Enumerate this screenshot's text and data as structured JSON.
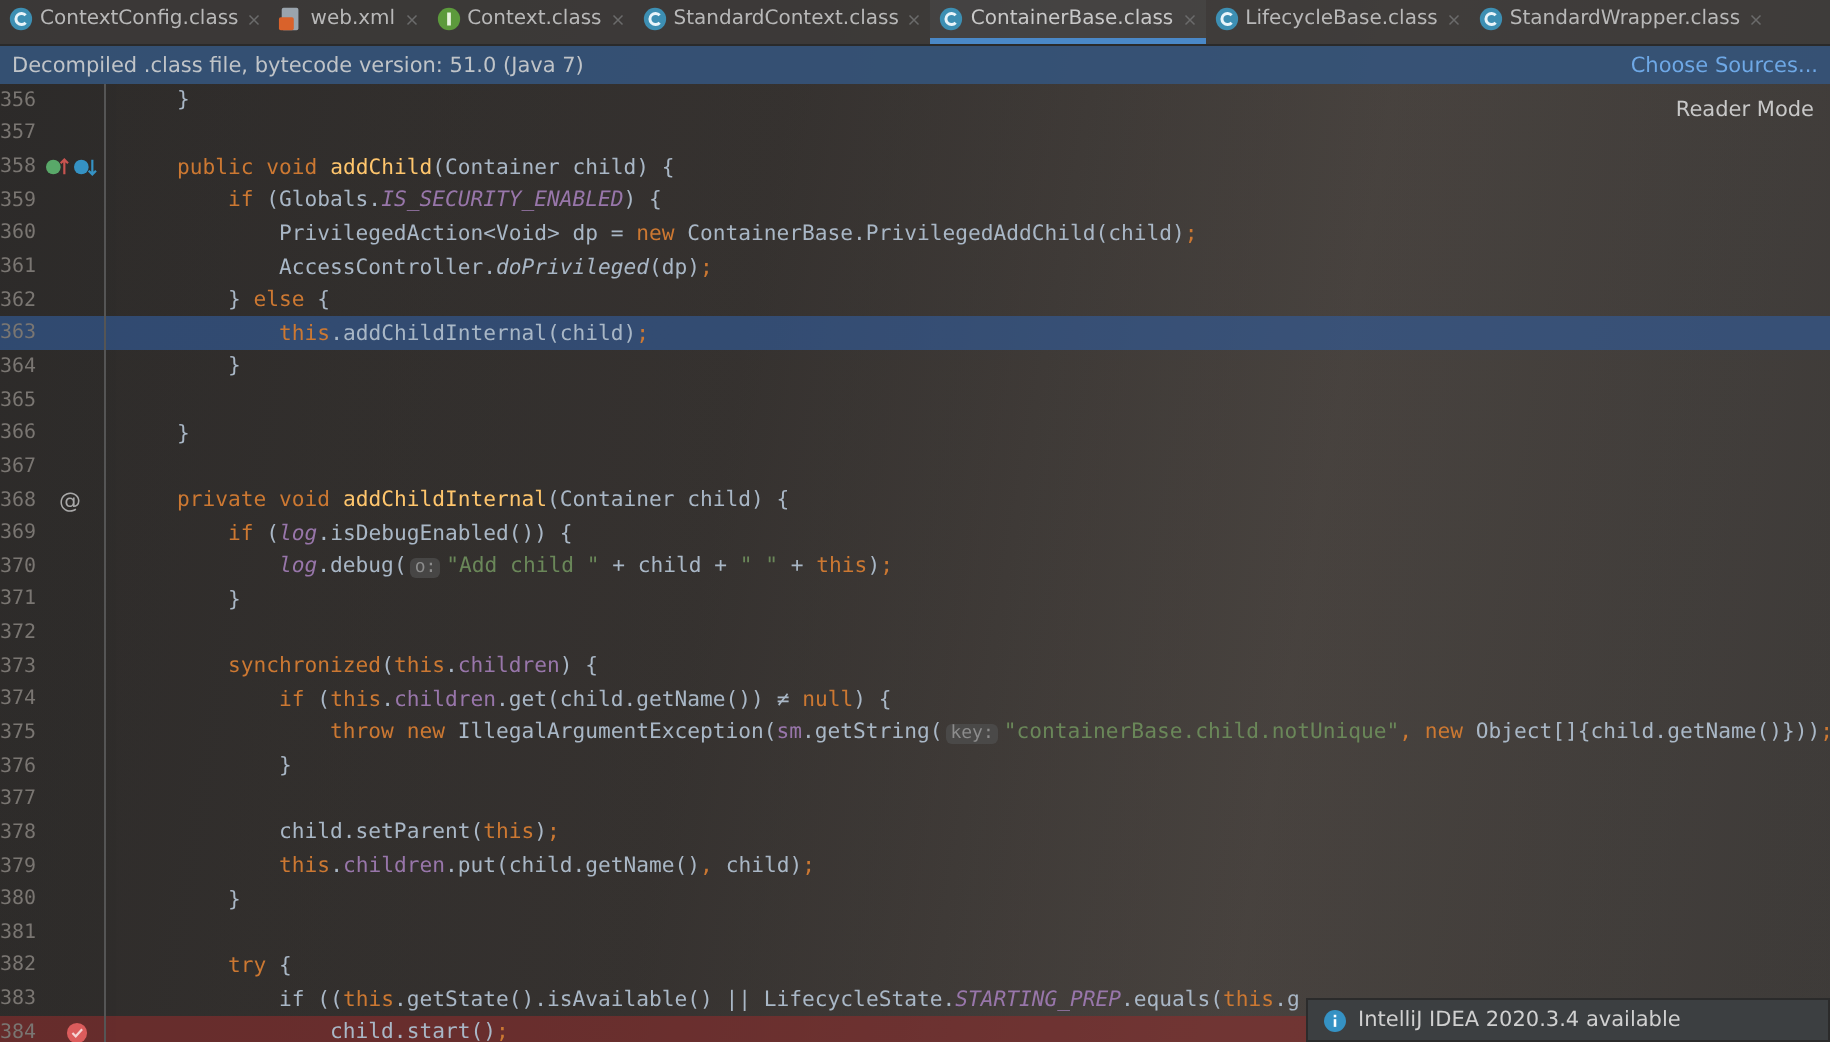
{
  "tabs": [
    {
      "label": "ContextConfig.class",
      "kind": "class",
      "selected": false
    },
    {
      "label": "web.xml",
      "kind": "xml",
      "selected": false
    },
    {
      "label": "Context.class",
      "kind": "interface",
      "selected": false
    },
    {
      "label": "StandardContext.class",
      "kind": "class",
      "selected": false
    },
    {
      "label": "ContainerBase.class",
      "kind": "class",
      "selected": true
    },
    {
      "label": "LifecycleBase.class",
      "kind": "class",
      "selected": false
    },
    {
      "label": "StandardWrapper.class",
      "kind": "class",
      "selected": false
    }
  ],
  "banner": {
    "message": "Decompiled .class file, bytecode version: 51.0 (Java 7)",
    "link": "Choose Sources..."
  },
  "reader_mode": "Reader Mode",
  "lines": [
    {
      "number": "356",
      "selected": false,
      "breakpoint": false,
      "tokens": [
        {
          "kind": "plain",
          "text": "    }"
        }
      ]
    },
    {
      "number": "357",
      "selected": false,
      "breakpoint": false
    },
    {
      "number": "358",
      "selected": false,
      "breakpoint": false,
      "gutter": [
        {
          "kind": "implemented"
        },
        {
          "kind": "overridden"
        }
      ],
      "tokens": [
        {
          "kind": "keyword",
          "text": "    public void "
        },
        {
          "kind": "declaration",
          "text": "addChild"
        },
        {
          "kind": "plain",
          "text": "(Container child) {"
        }
      ]
    },
    {
      "number": "359",
      "selected": false,
      "breakpoint": false,
      "tokens": [
        {
          "kind": "keyword",
          "text": "        if"
        },
        {
          "kind": "plain",
          "text": " (Globals."
        },
        {
          "kind": "static",
          "text": "IS_SECURITY_ENABLED"
        },
        {
          "kind": "plain",
          "text": ") {"
        }
      ]
    },
    {
      "number": "360",
      "selected": false,
      "breakpoint": false,
      "tokens": [
        {
          "kind": "plain",
          "text": "            PrivilegedAction<Void> dp = "
        },
        {
          "kind": "keyword",
          "text": "new"
        },
        {
          "kind": "plain",
          "text": " ContainerBase.PrivilegedAddChild(child)"
        },
        {
          "kind": "keyword",
          "text": ";"
        }
      ]
    },
    {
      "number": "361",
      "selected": false,
      "breakpoint": false,
      "tokens": [
        {
          "kind": "plain",
          "text": "            AccessController."
        },
        {
          "kind": "italic",
          "text": "doPrivileged"
        },
        {
          "kind": "plain",
          "text": "(dp)"
        },
        {
          "kind": "keyword",
          "text": ";"
        }
      ]
    },
    {
      "number": "362",
      "selected": false,
      "breakpoint": false,
      "tokens": [
        {
          "kind": "plain",
          "text": "        } "
        },
        {
          "kind": "keyword",
          "text": "else"
        },
        {
          "kind": "plain",
          "text": " {"
        }
      ]
    },
    {
      "number": "363",
      "selected": true,
      "breakpoint": false,
      "tokens": [
        {
          "kind": "keyword",
          "text": "            this"
        },
        {
          "kind": "plain",
          "text": ".addChildInternal(child)"
        },
        {
          "kind": "keyword",
          "text": ";"
        }
      ]
    },
    {
      "number": "364",
      "selected": false,
      "breakpoint": false,
      "tokens": [
        {
          "kind": "plain",
          "text": "        }"
        }
      ]
    },
    {
      "number": "365",
      "selected": false,
      "breakpoint": false
    },
    {
      "number": "366",
      "selected": false,
      "breakpoint": false,
      "tokens": [
        {
          "kind": "plain",
          "text": "    }"
        }
      ]
    },
    {
      "number": "367",
      "selected": false,
      "breakpoint": false
    },
    {
      "number": "368",
      "selected": false,
      "breakpoint": false,
      "gutter": [
        {
          "kind": "text",
          "text": "@"
        }
      ],
      "tokens": [
        {
          "kind": "keyword",
          "text": "    private void "
        },
        {
          "kind": "declaration",
          "text": "addChildInternal"
        },
        {
          "kind": "plain",
          "text": "(Container child) {"
        }
      ]
    },
    {
      "number": "369",
      "selected": false,
      "breakpoint": false,
      "tokens": [
        {
          "kind": "keyword",
          "text": "        if"
        },
        {
          "kind": "plain",
          "text": " ("
        },
        {
          "kind": "field-italic",
          "text": "log"
        },
        {
          "kind": "plain",
          "text": ".isDebugEnabled()) {"
        }
      ]
    },
    {
      "number": "370",
      "selected": false,
      "breakpoint": false,
      "tokens": [
        {
          "kind": "field-italic",
          "text": "            log"
        },
        {
          "kind": "plain",
          "text": ".debug("
        },
        {
          "kind": "hint",
          "text": "o:"
        },
        {
          "kind": "string",
          "text": "\"Add child \""
        },
        {
          "kind": "plain",
          "text": " + child + "
        },
        {
          "kind": "string",
          "text": "\" \""
        },
        {
          "kind": "plain",
          "text": " + "
        },
        {
          "kind": "keyword",
          "text": "this"
        },
        {
          "kind": "plain",
          "text": ")"
        },
        {
          "kind": "keyword",
          "text": ";"
        }
      ]
    },
    {
      "number": "371",
      "selected": false,
      "breakpoint": false,
      "tokens": [
        {
          "kind": "plain",
          "text": "        }"
        }
      ]
    },
    {
      "number": "372",
      "selected": false,
      "breakpoint": false
    },
    {
      "number": "373",
      "selected": false,
      "breakpoint": false,
      "tokens": [
        {
          "kind": "keyword",
          "text": "        synchronized"
        },
        {
          "kind": "plain",
          "text": "("
        },
        {
          "kind": "keyword",
          "text": "this"
        },
        {
          "kind": "plain",
          "text": "."
        },
        {
          "kind": "field",
          "text": "children"
        },
        {
          "kind": "plain",
          "text": ") {"
        }
      ]
    },
    {
      "number": "374",
      "selected": false,
      "breakpoint": false,
      "tokens": [
        {
          "kind": "keyword",
          "text": "            if"
        },
        {
          "kind": "plain",
          "text": " ("
        },
        {
          "kind": "keyword",
          "text": "this"
        },
        {
          "kind": "plain",
          "text": "."
        },
        {
          "kind": "field",
          "text": "children"
        },
        {
          "kind": "plain",
          "text": ".get(child.getName()) ≠ "
        },
        {
          "kind": "keyword",
          "text": "null"
        },
        {
          "kind": "plain",
          "text": ") {"
        }
      ]
    },
    {
      "number": "375",
      "selected": false,
      "breakpoint": false,
      "tokens": [
        {
          "kind": "keyword",
          "text": "                throw new"
        },
        {
          "kind": "plain",
          "text": " IllegalArgumentException("
        },
        {
          "kind": "field",
          "text": "sm"
        },
        {
          "kind": "plain",
          "text": ".getString("
        },
        {
          "kind": "hint",
          "text": "key:"
        },
        {
          "kind": "string",
          "text": "\"containerBase.child.notUnique\""
        },
        {
          "kind": "keyword",
          "text": ", new"
        },
        {
          "kind": "plain",
          "text": " Object[]{child.getName()}))"
        },
        {
          "kind": "keyword",
          "text": ";"
        }
      ]
    },
    {
      "number": "376",
      "selected": false,
      "breakpoint": false,
      "tokens": [
        {
          "kind": "plain",
          "text": "            }"
        }
      ]
    },
    {
      "number": "377",
      "selected": false,
      "breakpoint": false
    },
    {
      "number": "378",
      "selected": false,
      "breakpoint": false,
      "tokens": [
        {
          "kind": "plain",
          "text": "            child.setParent("
        },
        {
          "kind": "keyword",
          "text": "this"
        },
        {
          "kind": "plain",
          "text": ")"
        },
        {
          "kind": "keyword",
          "text": ";"
        }
      ]
    },
    {
      "number": "379",
      "selected": false,
      "breakpoint": false,
      "tokens": [
        {
          "kind": "keyword",
          "text": "            this"
        },
        {
          "kind": "plain",
          "text": "."
        },
        {
          "kind": "field",
          "text": "children"
        },
        {
          "kind": "plain",
          "text": ".put(child.getName()"
        },
        {
          "kind": "keyword",
          "text": ","
        },
        {
          "kind": "plain",
          "text": " child)"
        },
        {
          "kind": "keyword",
          "text": ";"
        }
      ]
    },
    {
      "number": "380",
      "selected": false,
      "breakpoint": false,
      "tokens": [
        {
          "kind": "plain",
          "text": "        }"
        }
      ]
    },
    {
      "number": "381",
      "selected": false,
      "breakpoint": false
    },
    {
      "number": "382",
      "selected": false,
      "breakpoint": false,
      "tokens": [
        {
          "kind": "keyword",
          "text": "        try"
        },
        {
          "kind": "plain",
          "text": " {"
        }
      ]
    },
    {
      "number": "383",
      "selected": false,
      "breakpoint": false,
      "tokens": [
        {
          "kind": "plain",
          "text": "            if (("
        },
        {
          "kind": "keyword",
          "text": "this"
        },
        {
          "kind": "plain",
          "text": ".getState().isAvailable() || LifecycleState."
        },
        {
          "kind": "static",
          "text": "STARTING_PREP"
        },
        {
          "kind": "plain",
          "text": ".equals("
        },
        {
          "kind": "keyword",
          "text": "this"
        },
        {
          "kind": "plain",
          "text": ".g"
        }
      ]
    },
    {
      "number": "384",
      "selected": false,
      "breakpoint": true,
      "gutter": [
        {
          "kind": "breakpoint"
        }
      ],
      "tokens": [
        {
          "kind": "plain",
          "text": "                child.start()"
        },
        {
          "kind": "keyword",
          "text": ";"
        }
      ]
    }
  ],
  "notification": {
    "message": "IntelliJ IDEA 2020.3.4 available"
  }
}
